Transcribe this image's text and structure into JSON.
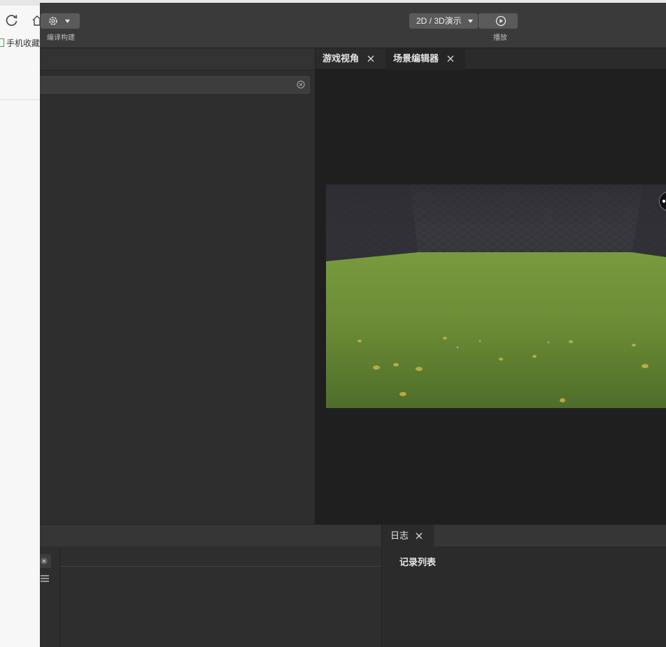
{
  "browser": {
    "favorites_label": "手机收藏"
  },
  "toolbar": {
    "build_label": "编译构建",
    "mode_select_value": "2D / 3D演示",
    "play_label": "播放"
  },
  "viewer": {
    "tabs": [
      {
        "label": "游戏视角"
      },
      {
        "label": "场景编辑器"
      }
    ]
  },
  "log": {
    "tab_label": "日志",
    "title": "记录列表"
  },
  "icons": {
    "reload": "reload-icon",
    "home": "home-icon",
    "settings": "gear-icon",
    "dropdown": "caret-down-icon",
    "play": "play-icon",
    "close": "close-icon",
    "clear": "clear-icon",
    "menu": "list-menu-icon",
    "gizmo": "view-gizmo-icon"
  },
  "colors": {
    "editor_bg": "#2b2b2b",
    "toolbar_bg": "#3a3a3a",
    "viewport_bg": "#1f1f1f",
    "grass": "#6b8a35",
    "wall": "#3d3c44"
  }
}
